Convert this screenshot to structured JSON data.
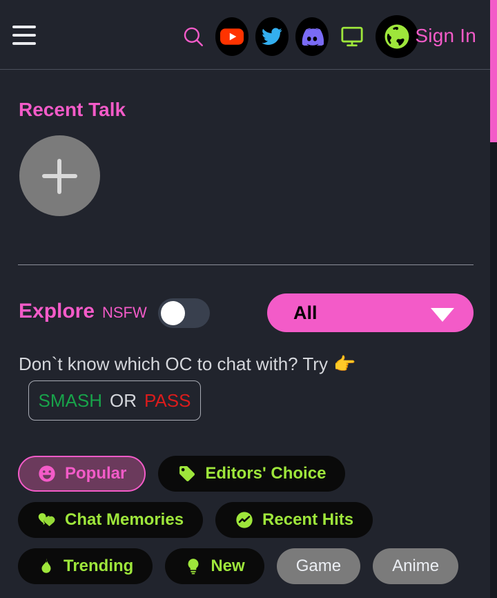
{
  "header": {
    "menu_icon": "hamburger-menu-icon",
    "icons": [
      {
        "name": "search-icon",
        "label": "Search",
        "color": "#F35BC8"
      },
      {
        "name": "youtube-icon",
        "label": "YouTube",
        "color": "#FF3300"
      },
      {
        "name": "twitter-icon",
        "label": "Twitter",
        "color": "#33AEEF"
      },
      {
        "name": "discord-icon",
        "label": "Discord",
        "color": "#7A6BF5"
      },
      {
        "name": "monitor-icon",
        "label": "Desktop",
        "color": "#9EE63B"
      },
      {
        "name": "globe-icon",
        "label": "Language",
        "color": "#9EE63B"
      }
    ],
    "sign_in_label": "Sign In"
  },
  "recent": {
    "title": "Recent Talk",
    "add_icon": "plus-icon"
  },
  "explore": {
    "title": "Explore",
    "nsfw_label": "NSFW",
    "nsfw_enabled": false,
    "filter_selected": "All",
    "filter_options": [
      "All"
    ],
    "chevron_icon": "chevron-down-icon"
  },
  "prompt": {
    "text": "Don`t know which OC to chat with? Try",
    "hand_icon": "👉",
    "smash": "SMASH",
    "or": "OR",
    "pass": "PASS",
    "smash_color": "#18A34A",
    "pass_color": "#DB1C1C"
  },
  "categories": [
    [
      {
        "label": "Popular",
        "icon": "smiley-icon",
        "state": "active"
      },
      {
        "label": "Editors' Choice",
        "icon": "tag-icon",
        "state": "default"
      }
    ],
    [
      {
        "label": "Chat Memories",
        "icon": "heart-chat-icon",
        "state": "default"
      },
      {
        "label": "Recent Hits",
        "icon": "chart-circle-icon",
        "state": "default"
      }
    ],
    [
      {
        "label": "Trending",
        "icon": "flame-icon",
        "state": "default"
      },
      {
        "label": "New",
        "icon": "lightbulb-icon",
        "state": "default"
      },
      {
        "label": "Game",
        "icon": "none",
        "state": "muted"
      },
      {
        "label": "Anime",
        "icon": "none",
        "state": "muted"
      }
    ]
  ],
  "theme": {
    "background": "#21242D",
    "accent_pink": "#F35BC8",
    "accent_green": "#9EE63B",
    "pill_background": "#0a0a0a",
    "muted_pill": "#7b7b7b"
  }
}
